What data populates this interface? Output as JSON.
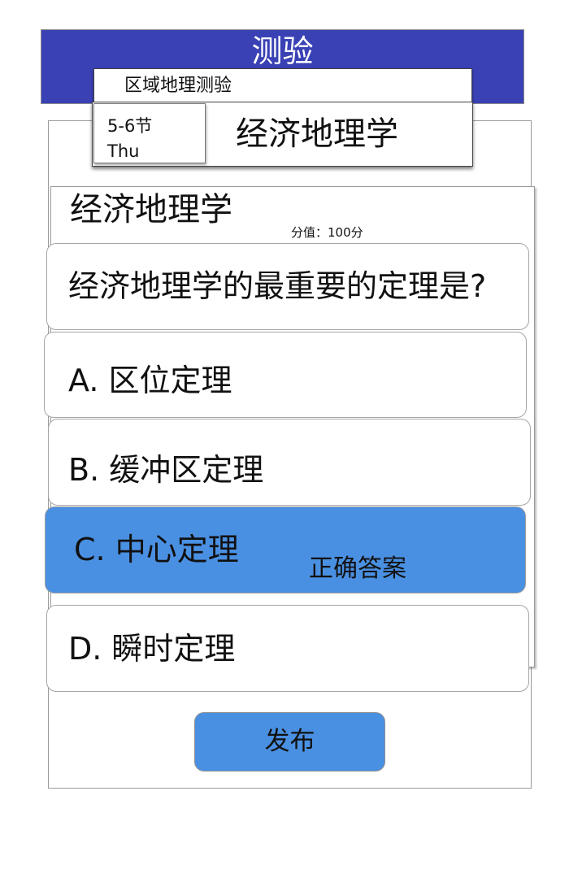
{
  "header": {
    "title": "测验",
    "subtitle": "区域地理测验"
  },
  "course": {
    "period": "5-6节",
    "day": "Thu",
    "name": "经济地理学"
  },
  "quiz": {
    "title": "经济地理学",
    "score": "分值：100分",
    "question": "经济地理学的最重要的定理是?",
    "options": [
      {
        "label": "A. 区位定理"
      },
      {
        "label": "B. 缓冲区定理"
      },
      {
        "label": "C. 中心定理",
        "tag": "正确答案"
      },
      {
        "label": "D. 瞬时定理"
      }
    ],
    "correct_index": 2
  },
  "actions": {
    "publish_label": "发布"
  },
  "colors": {
    "header": "#3a41b4",
    "accent": "#4a90e2"
  }
}
